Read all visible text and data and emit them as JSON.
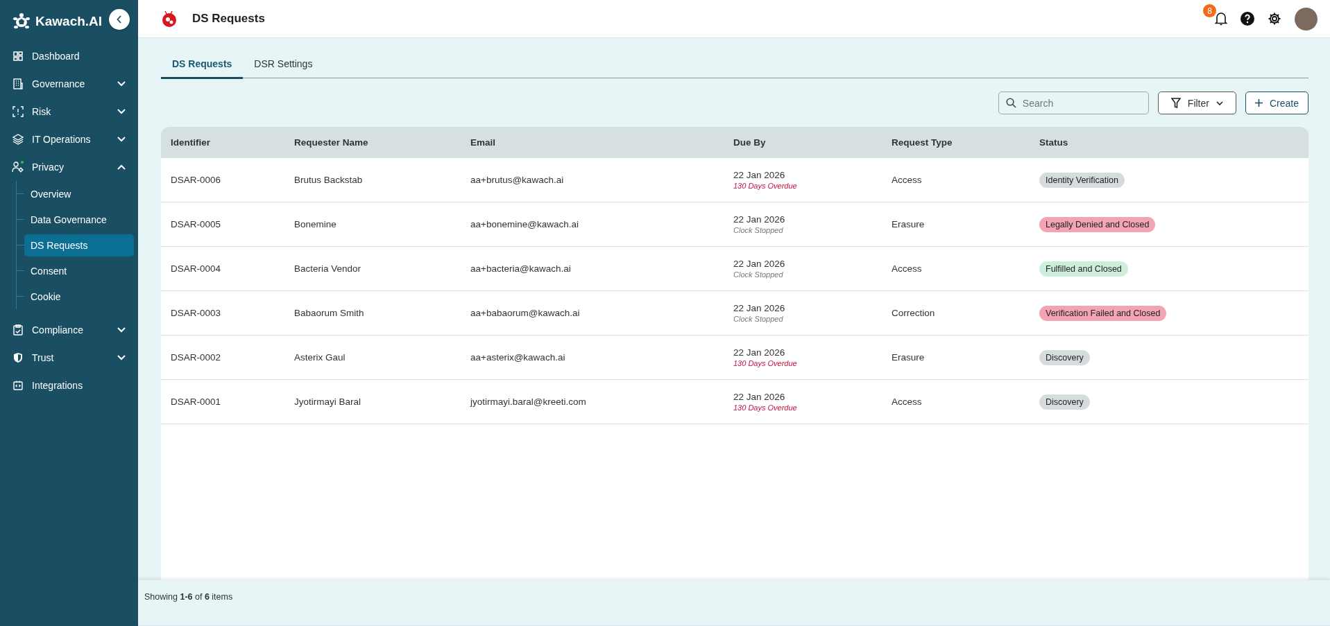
{
  "brand": {
    "name": "Kawach.AI"
  },
  "sidebar": {
    "items": [
      {
        "label": "Dashboard"
      },
      {
        "label": "Governance",
        "expanded": false
      },
      {
        "label": "Risk",
        "expanded": false
      },
      {
        "label": "IT Operations",
        "expanded": false
      },
      {
        "label": "Privacy",
        "expanded": true,
        "children": [
          {
            "label": "Overview",
            "selected": false
          },
          {
            "label": "Data Governance",
            "selected": false
          },
          {
            "label": "DS Requests",
            "selected": true
          },
          {
            "label": "Consent",
            "selected": false
          },
          {
            "label": "Cookie",
            "selected": false
          }
        ]
      },
      {
        "label": "Compliance",
        "expanded": false
      },
      {
        "label": "Trust",
        "expanded": false
      },
      {
        "label": "Integrations"
      }
    ]
  },
  "header": {
    "title": "DS Requests",
    "notification_count": "8"
  },
  "tabs": [
    {
      "label": "DS Requests",
      "selected": true
    },
    {
      "label": "DSR Settings",
      "selected": false
    }
  ],
  "toolbar": {
    "search": {
      "placeholder": "Search"
    },
    "filter": "Filter",
    "create": "Create"
  },
  "table": {
    "columns": [
      "Identifier",
      "Requester Name",
      "Email",
      "Due By",
      "Request Type",
      "Status"
    ],
    "rows": [
      {
        "identifier": "DSAR-0006",
        "requester": "Brutus Backstab",
        "email": "aa+brutus@kawach.ai",
        "due": "22 Jan 2026",
        "due_note": {
          "text": "130 Days Overdue",
          "kind": "overdue"
        },
        "type": "Access",
        "status": {
          "text": "Identity Verification",
          "color": "#d6dbdd"
        }
      },
      {
        "identifier": "DSAR-0005",
        "requester": "Bonemine",
        "email": "aa+bonemine@kawach.ai",
        "due": "22 Jan 2026",
        "due_note": {
          "text": "Clock Stopped",
          "kind": "stopped"
        },
        "type": "Erasure",
        "status": {
          "text": "Legally Denied and Closed",
          "color": "#f2a3b4"
        }
      },
      {
        "identifier": "DSAR-0004",
        "requester": "Bacteria Vendor",
        "email": "aa+bacteria@kawach.ai",
        "due": "22 Jan 2026",
        "due_note": {
          "text": "Clock Stopped",
          "kind": "stopped"
        },
        "type": "Access",
        "status": {
          "text": "Fulfilled and Closed",
          "color": "#cdeedb"
        }
      },
      {
        "identifier": "DSAR-0003",
        "requester": "Babaorum Smith",
        "email": "aa+babaorum@kawach.ai",
        "due": "22 Jan 2026",
        "due_note": {
          "text": "Clock Stopped",
          "kind": "stopped"
        },
        "type": "Correction",
        "status": {
          "text": "Verification Failed and Closed",
          "color": "#f2a3b4"
        }
      },
      {
        "identifier": "DSAR-0002",
        "requester": "Asterix Gaul",
        "email": "aa+asterix@kawach.ai",
        "due": "22 Jan 2026",
        "due_note": {
          "text": "130 Days Overdue",
          "kind": "overdue"
        },
        "type": "Erasure",
        "status": {
          "text": "Discovery",
          "color": "#d6dbdd"
        }
      },
      {
        "identifier": "DSAR-0001",
        "requester": "Jyotirmayi Baral",
        "email": "jyotirmayi.baral@kreeti.com",
        "due": "22 Jan 2026",
        "due_note": {
          "text": "130 Days Overdue",
          "kind": "overdue"
        },
        "type": "Access",
        "status": {
          "text": "Discovery",
          "color": "#d6dbdd"
        }
      }
    ]
  },
  "footer": {
    "summary": "Showing **1-6** of **6** items"
  }
}
